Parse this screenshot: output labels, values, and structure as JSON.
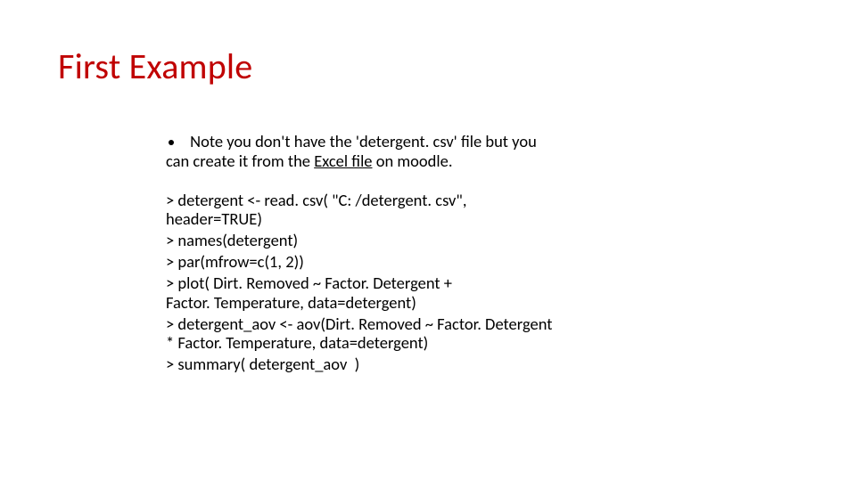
{
  "title": "First Example",
  "bullet": {
    "line1": " Note you don't have the 'detergent. csv' file but you",
    "line2_pre": "can create it from the ",
    "link_text": "Excel file",
    "line2_post": " on moodle."
  },
  "code": {
    "l1a": "> detergent <- read. csv( \"C: /detergent. csv\",",
    "l1b": "header=TRUE)",
    "l2": "> names(detergent)",
    "l3": "> par(mfrow=c(1, 2))",
    "l4a": "> plot( Dirt. Removed ~ Factor. Detergent +",
    "l4b": "Factor. Temperature, data=detergent)",
    "l5a": "> detergent_aov <- aov(Dirt. Removed ~ Factor. Detergent",
    "l5b": "* Factor. Temperature, data=detergent)",
    "l6": "> summary( detergent_aov  )"
  }
}
